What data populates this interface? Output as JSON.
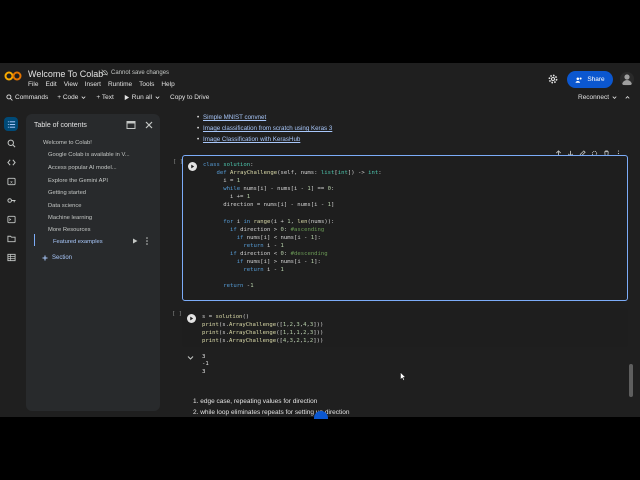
{
  "header": {
    "title": "Welcome To Colab",
    "save_status": "Cannot save changes",
    "menu": [
      "File",
      "Edit",
      "View",
      "Insert",
      "Runtime",
      "Tools",
      "Help"
    ],
    "share_label": "Share",
    "brand_color": "#f9ab00",
    "accent_color": "#0b57d0"
  },
  "toolbar": {
    "commands": "Commands",
    "code": "+ Code",
    "text": "+ Text",
    "run_all": "Run all",
    "copy_to_drive": "Copy to Drive",
    "reconnect": "Reconnect"
  },
  "rail_icons": [
    "list-icon",
    "search-icon",
    "code-brackets-icon",
    "variables-icon",
    "key-icon",
    "terminal-icon",
    "folder-icon",
    "table-icon"
  ],
  "toc": {
    "title": "Table of contents",
    "items": [
      "Welcome to Colab!",
      "Google Colab is available in V...",
      "Access popular AI model...",
      "Explore the Gemini API",
      "Getting started",
      "Data science",
      "Machine learning",
      "More Resources",
      "Featured examples"
    ],
    "section_label": "Section"
  },
  "notebook": {
    "links": [
      "Simple MNIST convnet",
      "Image classification from scratch using Keras 3",
      "Image Classification with KerasHub"
    ],
    "cell1_count": "[ ]",
    "cell2_count": "[ ]",
    "output_lines": "3\n-1\n3",
    "list_items": [
      "1. edge case, repeating values for direction",
      "2. while loop eliminates repeats for setting up direction"
    ]
  }
}
